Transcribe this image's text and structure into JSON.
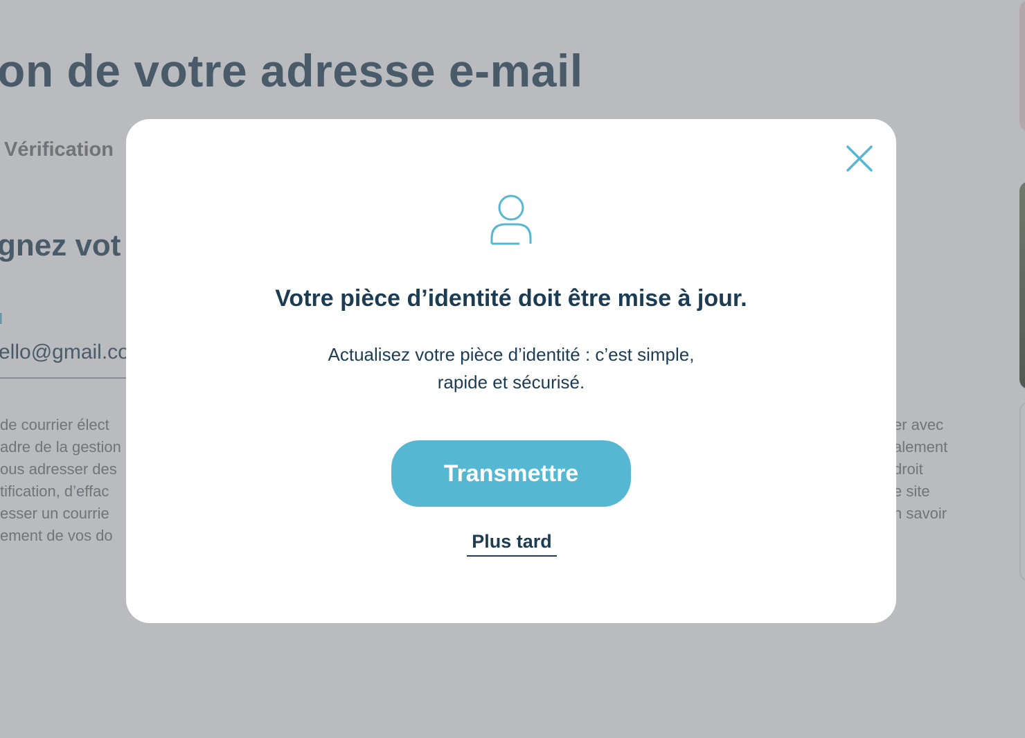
{
  "background": {
    "title": "on de votre adresse e-mail",
    "step": "Vérification",
    "subtitle": "gnez vot",
    "field_label": "l",
    "field_value": "ello@gmail.co",
    "legal_left": [
      "de courrier élect",
      "adre de la gestion",
      "ous adresser des",
      "tification, d’effac",
      "esser un courrie",
      "ement de vos do"
    ],
    "legal_right": [
      "er avec",
      "alement",
      "droit",
      "e site",
      "n savoir"
    ]
  },
  "modal": {
    "icon": "user-icon",
    "title": "Votre pièce d’identité doit être mise à jour.",
    "body_line1": "Actualisez votre pièce d’identité : c’est simple,",
    "body_line2": "rapide et sécurisé.",
    "primary_button": "Transmettre",
    "secondary_link": "Plus tard",
    "close_icon": "close-icon"
  },
  "colors": {
    "accent": "#56b7d3",
    "text_dark": "#1c3c53",
    "overlay": "#75777d"
  }
}
